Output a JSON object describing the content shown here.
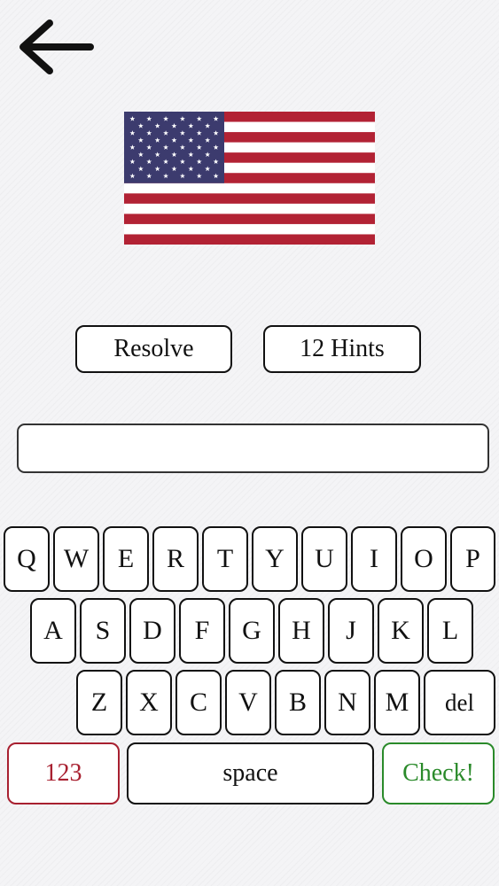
{
  "buttons": {
    "resolve": "Resolve",
    "hints": "12 Hints"
  },
  "answer": {
    "value": ""
  },
  "keyboard": {
    "row1": [
      "Q",
      "W",
      "E",
      "R",
      "T",
      "Y",
      "U",
      "I",
      "O",
      "P"
    ],
    "row2": [
      "A",
      "S",
      "D",
      "F",
      "G",
      "H",
      "J",
      "K",
      "L"
    ],
    "row3": [
      "Z",
      "X",
      "C",
      "V",
      "B",
      "N",
      "M"
    ],
    "del": "del",
    "numbers": "123",
    "space": "space",
    "check": "Check!"
  },
  "colors": {
    "numbers_key": "#a82030",
    "check_key": "#2a8a2a",
    "flag_red": "#b22234",
    "flag_blue": "#3c3b6e"
  },
  "icons": {
    "back": "arrow-left-icon",
    "flag": "united-states-flag"
  }
}
